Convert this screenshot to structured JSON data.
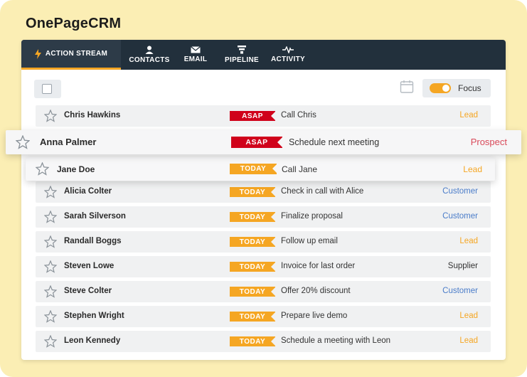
{
  "brand": "OnePageCRM",
  "nav": {
    "action_stream": "ACTION STREAM",
    "contacts": "CONTACTS",
    "email": "EMAIL",
    "pipeline": "PIPELINE",
    "activity": "ACTIVITY"
  },
  "toolbar": {
    "focus_label": "Focus"
  },
  "rows": [
    {
      "name": "Chris Hawkins",
      "badge": "ASAP",
      "task": "Call Chris",
      "status": "Lead"
    },
    {
      "name": "Anna Palmer",
      "badge": "ASAP",
      "task": "Schedule next meeting",
      "status": "Prospect"
    },
    {
      "name": "Jane Doe",
      "badge": "TODAY",
      "task": "Call Jane",
      "status": "Lead"
    },
    {
      "name": "Alicia Colter",
      "badge": "TODAY",
      "task": "Check in call with Alice",
      "status": "Customer"
    },
    {
      "name": "Sarah Silverson",
      "badge": "TODAY",
      "task": "Finalize proposal",
      "status": "Customer"
    },
    {
      "name": "Randall Boggs",
      "badge": "TODAY",
      "task": "Follow up email",
      "status": "Lead"
    },
    {
      "name": "Steven Lowe",
      "badge": "TODAY",
      "task": "Invoice for last order",
      "status": "Supplier"
    },
    {
      "name": "Steve Colter",
      "badge": "TODAY",
      "task": "Offer 20% discount",
      "status": "Customer"
    },
    {
      "name": "Stephen Wright",
      "badge": "TODAY",
      "task": "Prepare live demo",
      "status": "Lead"
    },
    {
      "name": "Leon Kennedy",
      "badge": "TODAY",
      "task": "Schedule a meeting with Leon",
      "status": "Lead"
    }
  ],
  "colors": {
    "navbar": "#22303c",
    "accent": "#f5a623",
    "asap": "#d0021b",
    "lead": "#f5a623",
    "customer": "#4a7cc9",
    "prospect": "#d94a5a"
  }
}
